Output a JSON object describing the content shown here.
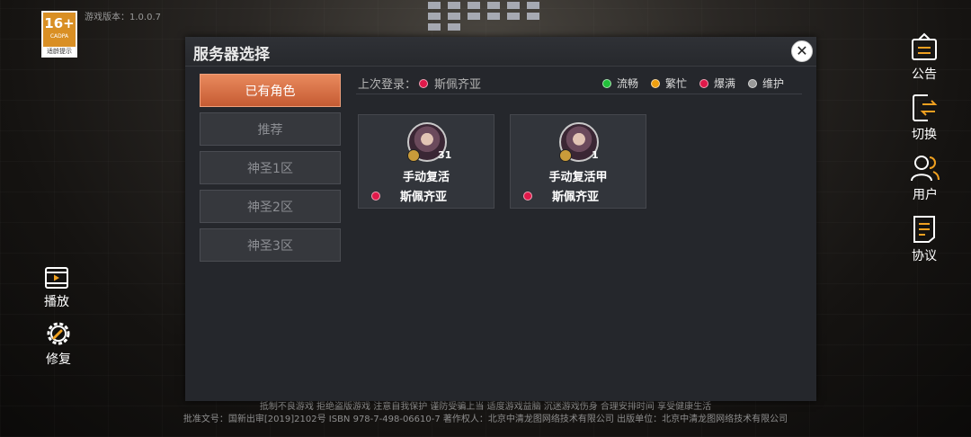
{
  "app": {
    "version": "游戏版本：1.0.0.7",
    "age_badge": {
      "age": "16+",
      "org": "CADPA",
      "tip": "适龄提示"
    }
  },
  "left_menu": [
    {
      "label": "播放",
      "icon": "film-play-icon"
    },
    {
      "label": "修复",
      "icon": "gear-wrench-icon"
    }
  ],
  "right_menu": [
    {
      "label": "公告",
      "icon": "notice-icon"
    },
    {
      "label": "切换",
      "icon": "switch-icon"
    },
    {
      "label": "用户",
      "icon": "user-icon"
    },
    {
      "label": "协议",
      "icon": "agreement-icon"
    }
  ],
  "dialog": {
    "title": "服务器选择",
    "close_icon": "close-icon",
    "tabs": [
      {
        "label": "已有角色",
        "active": true
      },
      {
        "label": "推荐",
        "active": false
      },
      {
        "label": "神圣1区",
        "active": false
      },
      {
        "label": "神圣2区",
        "active": false
      },
      {
        "label": "神圣3区",
        "active": false
      }
    ],
    "last_login": {
      "label": "上次登录：",
      "server": "斯佩齐亚",
      "status_color": "#e0194a"
    },
    "legend": [
      {
        "label": "流畅",
        "color": "#22c13a"
      },
      {
        "label": "繁忙",
        "color": "#f0a010"
      },
      {
        "label": "爆满",
        "color": "#e0194a"
      },
      {
        "label": "维护",
        "color": "#9a9a9a"
      }
    ],
    "characters": [
      {
        "name": "手动复活",
        "level": "31",
        "server": "斯佩齐亚",
        "status_color": "#e0194a"
      },
      {
        "name": "手动复活甲",
        "level": "1",
        "server": "斯佩齐亚",
        "status_color": "#e0194a"
      }
    ]
  },
  "footer": {
    "line1": "抵制不良游戏  拒绝盗版游戏  注意自我保护  谨防受骗上当  适度游戏益脑  沉迷游戏伤身  合理安排时间  享受健康生活",
    "line2": "批准文号：国新出审[2019]2102号  ISBN 978-7-498-06610-7  著作权人：北京中清龙图网络技术有限公司  出版单位：北京中清龙图网络技术有限公司"
  }
}
